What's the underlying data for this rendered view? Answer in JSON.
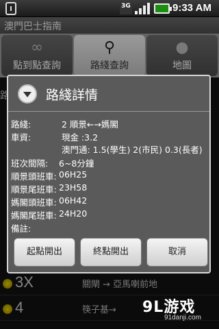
{
  "status": {
    "network_badge": "3G",
    "time": "9:33 AM"
  },
  "app": {
    "title": "澳門巴士指南"
  },
  "tabs": [
    {
      "label": "點到點查詢",
      "icon": "link-icon",
      "active": false
    },
    {
      "label": "路綫查詢",
      "icon": "search-icon",
      "active": true
    },
    {
      "label": "地圖",
      "icon": "map-pin-icon",
      "active": false
    }
  ],
  "background": {
    "side_label": "路",
    "rows": [
      {
        "number": "3X",
        "desc": "關閘 → 亞馬喇前地"
      },
      {
        "number": "4",
        "desc": "筷子基→"
      }
    ]
  },
  "dialog": {
    "title": "路綫詳情",
    "route_label": "路綫:",
    "route_value": "2 順景←→媽閣",
    "fare_label": "車資:",
    "fare_cash": "現金 :3.2",
    "fare_macaupass": "澳門通: 1.5(學生) 2(市民) 0.3(長者)",
    "interval_label": "班次間隔:",
    "interval_value": "6~8分鐘",
    "first_a_label": "順景頭班車:",
    "first_a_value": "06H25",
    "last_a_label": "順景尾班車:",
    "last_a_value": "23H58",
    "first_b_label": "媽閣頭班車:",
    "first_b_value": "06H42",
    "last_b_label": "媽閣尾班車:",
    "last_b_value": "24H20",
    "remark_label": "備註:",
    "buttons": {
      "start": "起點開出",
      "end": "終點開出",
      "cancel": "取消"
    }
  },
  "watermark": {
    "brand": "9L游戏",
    "site": "91danji.com"
  }
}
